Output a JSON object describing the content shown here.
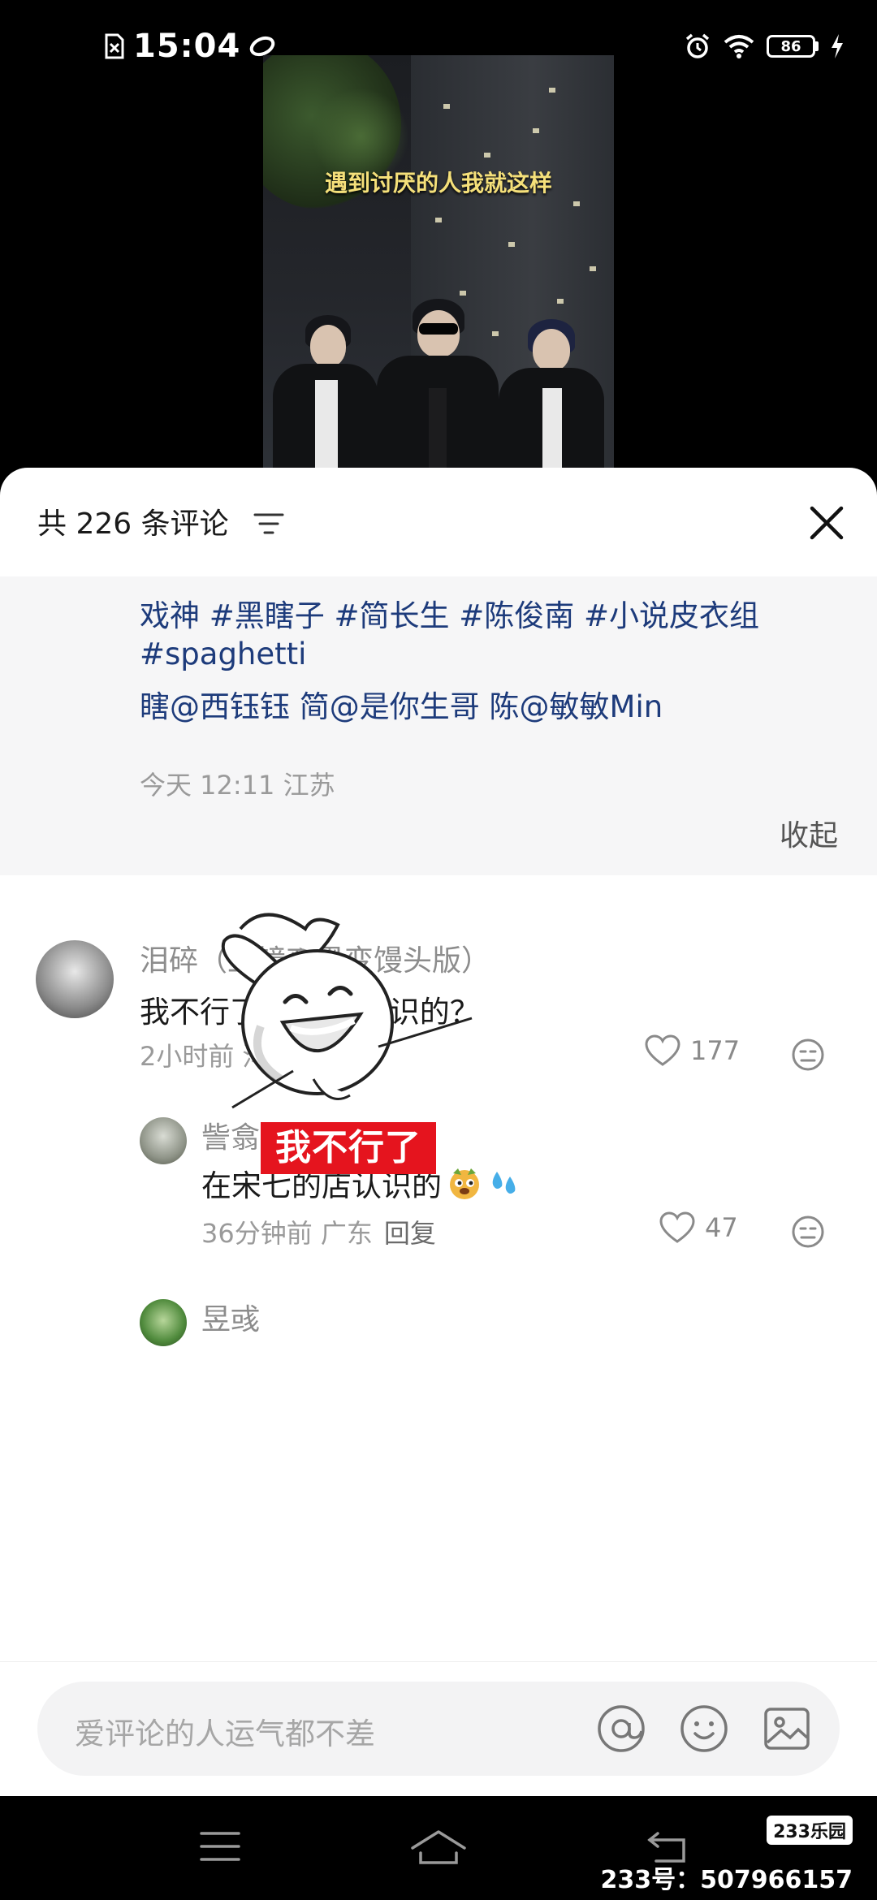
{
  "status_bar": {
    "time": "15:04",
    "battery": "86"
  },
  "video": {
    "caption": "遇到讨厌的人我就这样"
  },
  "comments_header": {
    "count_text": "共 226 条评论"
  },
  "post_caption": {
    "line1": "戏神 #黑瞎子 #简长生 #陈俊南 #小说皮衣组",
    "line2": "#spaghetti",
    "line3": "瞎@西钰钰 简@是你生哥 陈@敏敏Min",
    "meta": "今天 12:11 江苏",
    "collapse": "收起"
  },
  "comments": [
    {
      "user": "泪碎（上镜变黑变馒头版）",
      "text": "我不行了 皮衣店认识的？",
      "time_loc": "2小时前 河北",
      "reply": "回复",
      "likes": "177"
    }
  ],
  "replies": [
    {
      "user": "訾翕",
      "text": "在宋七的店认识的",
      "time_loc": "36分钟前 广东",
      "reply": "回复",
      "likes": "47"
    },
    {
      "user": "昱彧",
      "sticker_text": "我不行了"
    }
  ],
  "input": {
    "placeholder": "爱评论的人运气都不差"
  },
  "watermark": {
    "badge": "233乐园",
    "text": "233号：507966157"
  },
  "colors": {
    "hashtag": "#1d3b7b",
    "sticker_red": "#e5141e"
  }
}
